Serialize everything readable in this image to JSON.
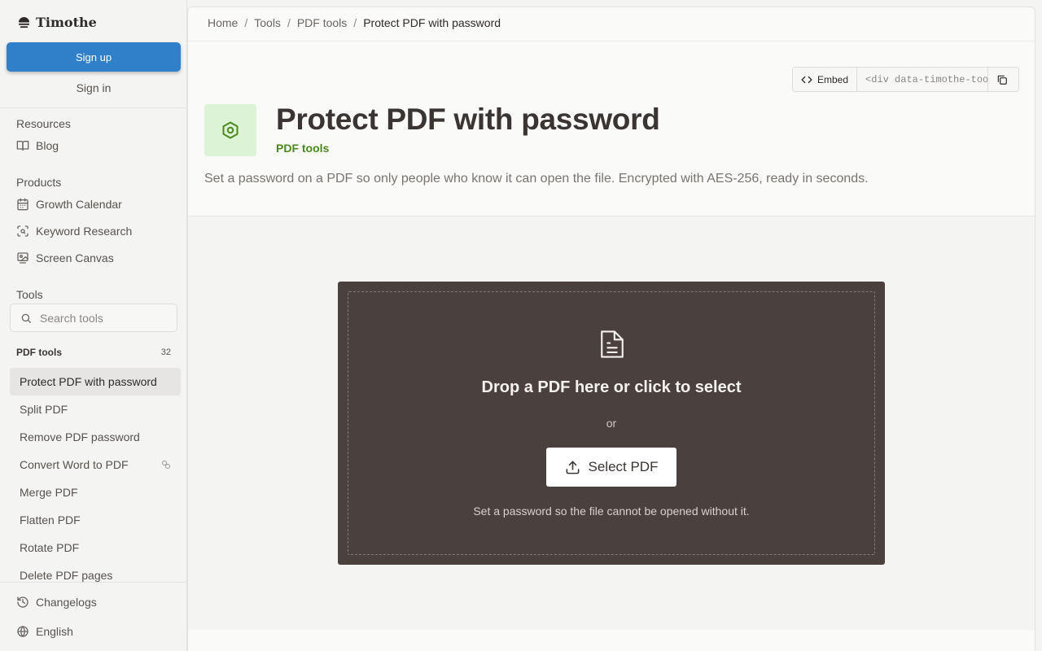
{
  "brand": {
    "name": "Timothe"
  },
  "auth": {
    "signup_label": "Sign up",
    "signin_label": "Sign in"
  },
  "sidebar": {
    "resources_title": "Resources",
    "resources": [
      {
        "label": "Blog",
        "icon": "book-icon"
      }
    ],
    "products_title": "Products",
    "products": [
      {
        "label": "Growth Calendar",
        "icon": "calendar-icon"
      },
      {
        "label": "Keyword Research",
        "icon": "scan-search-icon"
      },
      {
        "label": "Screen Canvas",
        "icon": "image-icon"
      }
    ],
    "tools_title": "Tools",
    "search_placeholder": "Search tools",
    "category": {
      "name": "PDF tools",
      "count": "32"
    },
    "tool_items": [
      {
        "label": "Protect PDF with password",
        "active": true
      },
      {
        "label": "Split PDF"
      },
      {
        "label": "Remove PDF password"
      },
      {
        "label": "Convert Word to PDF",
        "badge_icon": "link-icon"
      },
      {
        "label": "Merge PDF"
      },
      {
        "label": "Flatten PDF"
      },
      {
        "label": "Rotate PDF"
      },
      {
        "label": "Delete PDF pages"
      }
    ],
    "bottom": [
      {
        "label": "Changelogs",
        "icon": "history-icon"
      },
      {
        "label": "English",
        "icon": "globe-icon"
      }
    ]
  },
  "breadcrumb": [
    "Home",
    "Tools",
    "PDF tools",
    "Protect PDF with password"
  ],
  "embed": {
    "label": "Embed",
    "code": "<div data-timothe-tool=\"protect-pdf\"></div>"
  },
  "page": {
    "title": "Protect PDF with password",
    "category": "PDF tools",
    "description": "Set a password on a PDF so only people who know it can open the file. Encrypted with AES-256, ready in seconds.",
    "icon": "hexagon-icon"
  },
  "dropzone": {
    "title": "Drop a PDF here or click to select",
    "or_label": "or",
    "button_label": "Select PDF",
    "hint": "Set a password so the file cannot be opened without it."
  },
  "colors": {
    "accent_blue": "#2f80c9",
    "category_green": "#4a8a1e",
    "icon_bg": "#ddf3d6",
    "dropzone_bg": "#4a413e"
  }
}
